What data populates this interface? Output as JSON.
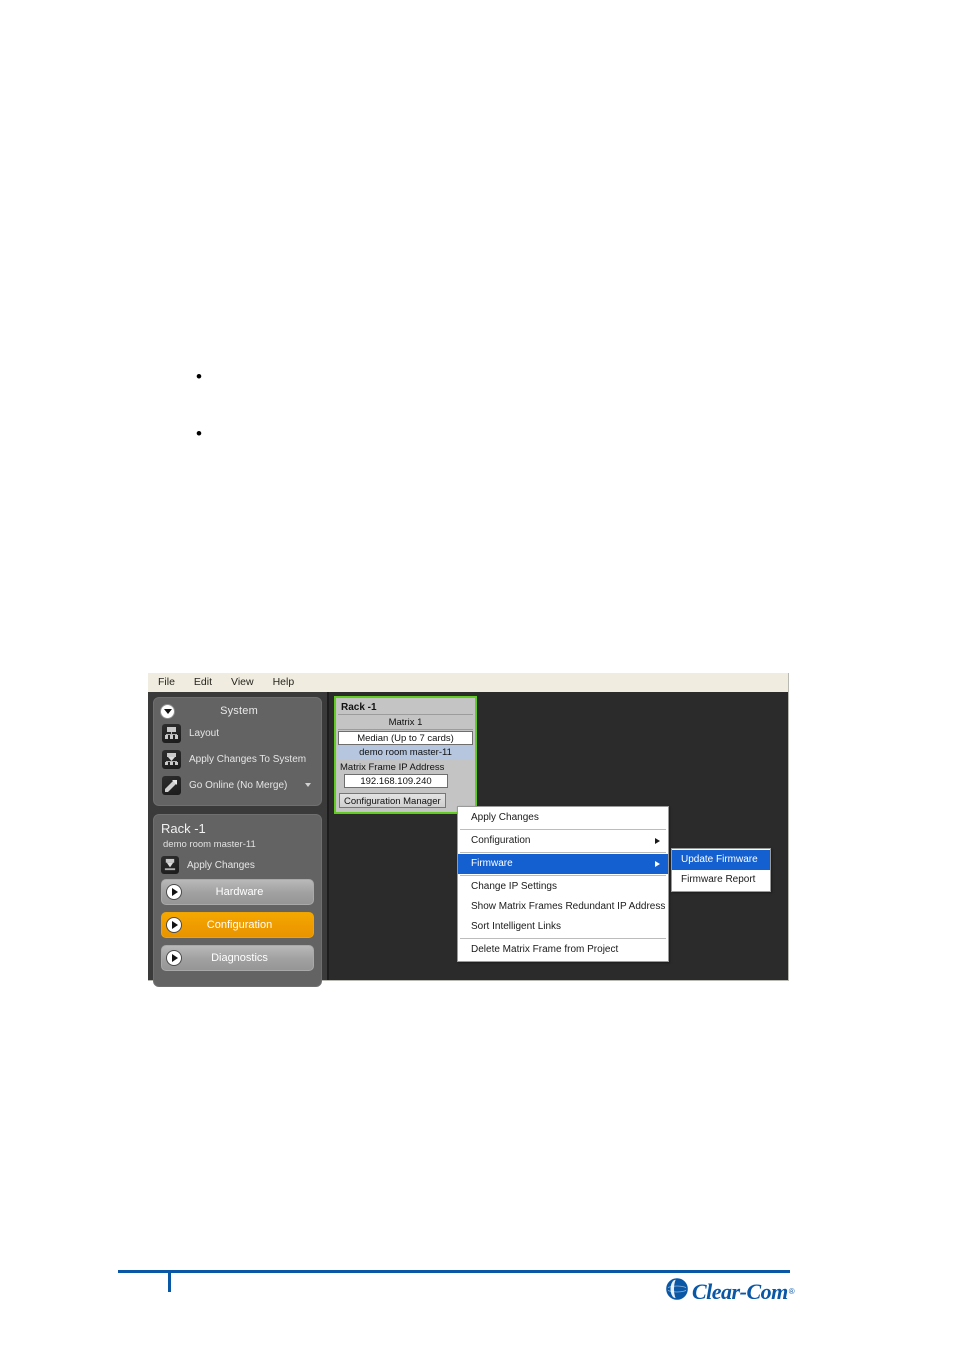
{
  "document": {
    "bullets": [
      {
        "text": ""
      },
      {
        "text": ""
      }
    ]
  },
  "app": {
    "menu_bar": [
      {
        "label": "File"
      },
      {
        "label": "Edit"
      },
      {
        "label": "View"
      },
      {
        "label": "Help"
      }
    ],
    "navigator": {
      "system_panel": {
        "title": "System",
        "collapse_icon": "chevron-down-icon",
        "items": [
          {
            "label": "Layout",
            "icon": "layout-icon"
          },
          {
            "label": "Apply Changes To System",
            "icon": "apply-changes-icon"
          },
          {
            "label": "Go Online (No Merge)",
            "icon": "go-online-icon",
            "has_dropdown": true
          }
        ]
      },
      "rack_panel": {
        "title": "Rack -1",
        "subtitle": "demo room master-11",
        "apply_changes_label": "Apply Changes",
        "apply_changes_icon": "apply-changes-icon",
        "buttons": [
          {
            "label": "Hardware",
            "active": false
          },
          {
            "label": "Configuration",
            "active": true
          },
          {
            "label": "Diagnostics",
            "active": false
          }
        ]
      }
    },
    "workspace": {
      "frame_card": {
        "name": "Rack -1",
        "matrix": "Matrix 1",
        "model": "Median (Up to 7 cards)",
        "device": "demo room master-11",
        "ip_label": "Matrix Frame IP Address",
        "ip_value": "192.168.109.240",
        "config_manager_label": "Configuration Manager",
        "selection_color": "#63cc22"
      },
      "context_menu": {
        "items": [
          {
            "label": "Apply Changes",
            "submenu": false,
            "highlight": false,
            "separator_after": false
          },
          {
            "label": "Configuration",
            "submenu": true,
            "highlight": false,
            "separator_after": false
          },
          {
            "label": "Firmware",
            "submenu": true,
            "highlight": true,
            "separator_after": true
          },
          {
            "label": "Change IP Settings",
            "submenu": false,
            "highlight": false,
            "separator_after": false
          },
          {
            "label": "Show Matrix Frames Redundant IP Address",
            "submenu": false,
            "highlight": false,
            "separator_after": false
          },
          {
            "label": "Sort Intelligent Links",
            "submenu": false,
            "highlight": false,
            "separator_after": true
          },
          {
            "label": "Delete Matrix Frame from Project",
            "submenu": false,
            "highlight": false,
            "separator_after": false
          }
        ],
        "highlight_color": "#1560d0"
      },
      "context_submenu": {
        "items": [
          {
            "label": "Update Firmware",
            "highlight": true
          },
          {
            "label": "Firmware Report",
            "highlight": false
          }
        ]
      }
    }
  },
  "footer": {
    "brand": "Clear-Com",
    "trademark": "®",
    "logo_icon": "clearcom-globe-icon",
    "accent_color": "#0a57a5"
  }
}
